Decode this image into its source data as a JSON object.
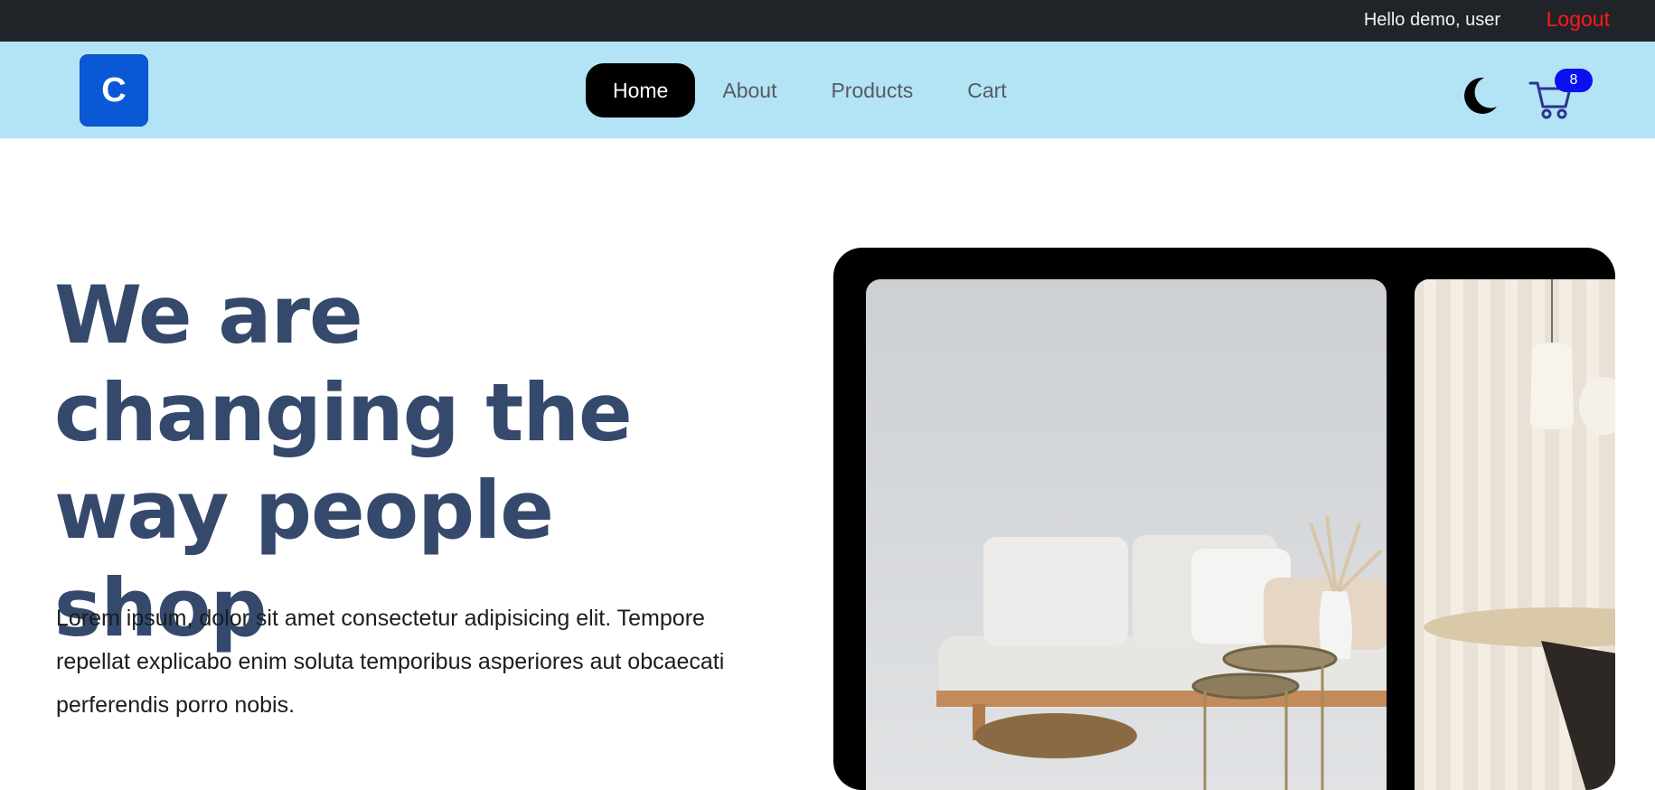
{
  "topbar": {
    "greeting": "Hello demo, user",
    "logout_label": "Logout"
  },
  "navbar": {
    "logo_letter": "C",
    "links": [
      {
        "label": "Home",
        "active": true
      },
      {
        "label": "About",
        "active": false
      },
      {
        "label": "Products",
        "active": false
      },
      {
        "label": "Cart",
        "active": false
      }
    ],
    "theme_icon": "moon-icon",
    "cart_icon": "shopping-cart-icon",
    "cart_count": "8"
  },
  "hero": {
    "title": "We are changing the way people shop",
    "description": "Lorem ipsum, dolor sit amet consectetur adipisicing elit. Tempore repellat explicabo enim soluta temporibus asperiores aut obcaecati perferendis porro nobis."
  },
  "colors": {
    "topbar_bg": "#202428",
    "navbar_bg": "#b3e4f6",
    "logo_bg": "#0a58d6",
    "logout": "#ff1a1a",
    "title": "#35496d",
    "badge_bg": "#0a10f0"
  }
}
